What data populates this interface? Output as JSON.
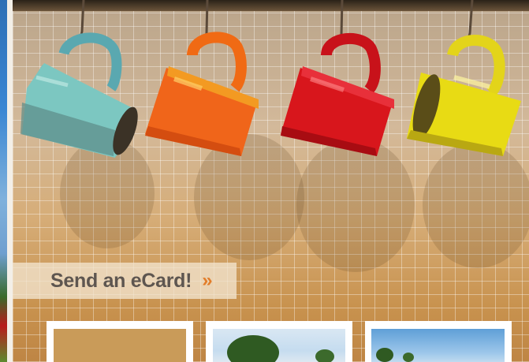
{
  "banner": {
    "label": "Send an eCard!",
    "arrow": "»"
  },
  "mugs": [
    {
      "color": "#7ec9c4",
      "name": "turquoise"
    },
    {
      "color": "#f06a14",
      "name": "orange"
    },
    {
      "color": "#d7141c",
      "name": "red"
    },
    {
      "color": "#e9dd12",
      "name": "yellow"
    }
  ],
  "colors": {
    "accent": "#e27d2a",
    "banner_text": "#5e5650"
  }
}
